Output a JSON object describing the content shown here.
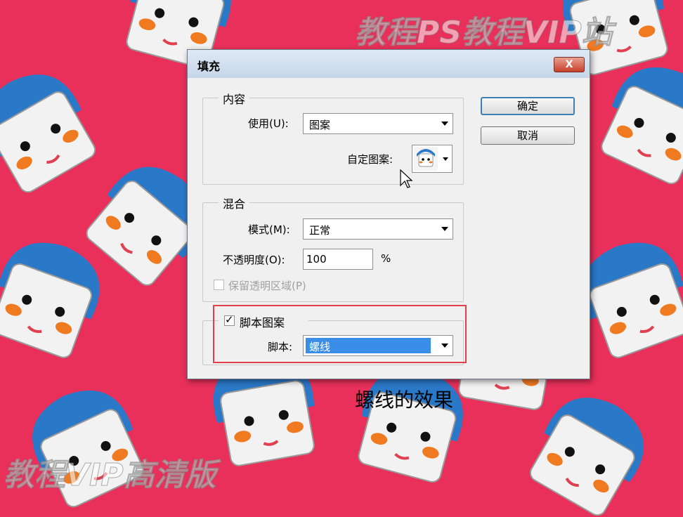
{
  "background": {
    "accent_color": "#e8305a",
    "watermark_top": "教程PS教程VIP站",
    "watermark_bottom": "教程VIP高清版"
  },
  "dialog": {
    "title": "填充",
    "close_label": "X",
    "content_group": {
      "legend": "内容",
      "use_label": "使用(U):",
      "use_value": "图案",
      "custom_pattern_label": "自定图案:"
    },
    "blend_group": {
      "legend": "混合",
      "mode_label": "模式(M):",
      "mode_value": "正常",
      "opacity_label": "不透明度(O):",
      "opacity_value": "100",
      "opacity_unit": "%",
      "preserve_transparency_label": "保留透明区域(P)"
    },
    "script_group": {
      "checkbox_label": "脚本图案",
      "checked": true,
      "script_label": "脚本:",
      "script_value": "螺线"
    },
    "buttons": {
      "ok": "确定",
      "cancel": "取消"
    }
  },
  "caption": "螺线的效果"
}
